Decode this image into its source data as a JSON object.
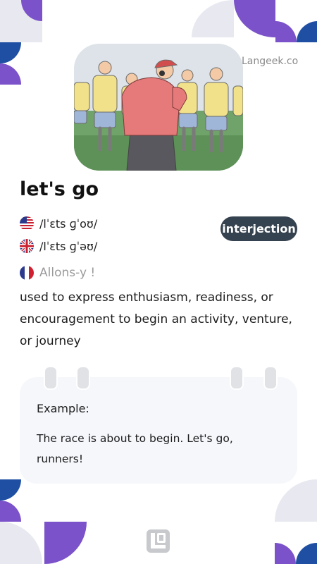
{
  "header": {
    "site_label": "Langeek.co"
  },
  "entry": {
    "word": "let's go",
    "part_of_speech": "interjection",
    "pronunciations": [
      {
        "accent_icon": "us-flag-icon",
        "ipa": "/lˈɛts ɡˈoʊ/"
      },
      {
        "accent_icon": "uk-flag-icon",
        "ipa": "/lˈɛts ɡˈəʊ/"
      }
    ],
    "translation": {
      "flag_icon": "france-flag-icon",
      "text": "Allons-y !"
    },
    "definition": "used to express enthusiasm, readiness, or encouragement to begin an activity, venture, or journey"
  },
  "example": {
    "title": "Example:",
    "sentence": "The race is about to begin. Let's go, runners!"
  },
  "footer": {
    "logo_icon": "langeek-logo-icon"
  },
  "colors": {
    "accent_purple": "#7b52c9",
    "accent_blue": "#1e4fa3",
    "light_gray": "#e8e9f0",
    "badge_bg": "#35424f",
    "card_bg": "#f6f7fb"
  }
}
